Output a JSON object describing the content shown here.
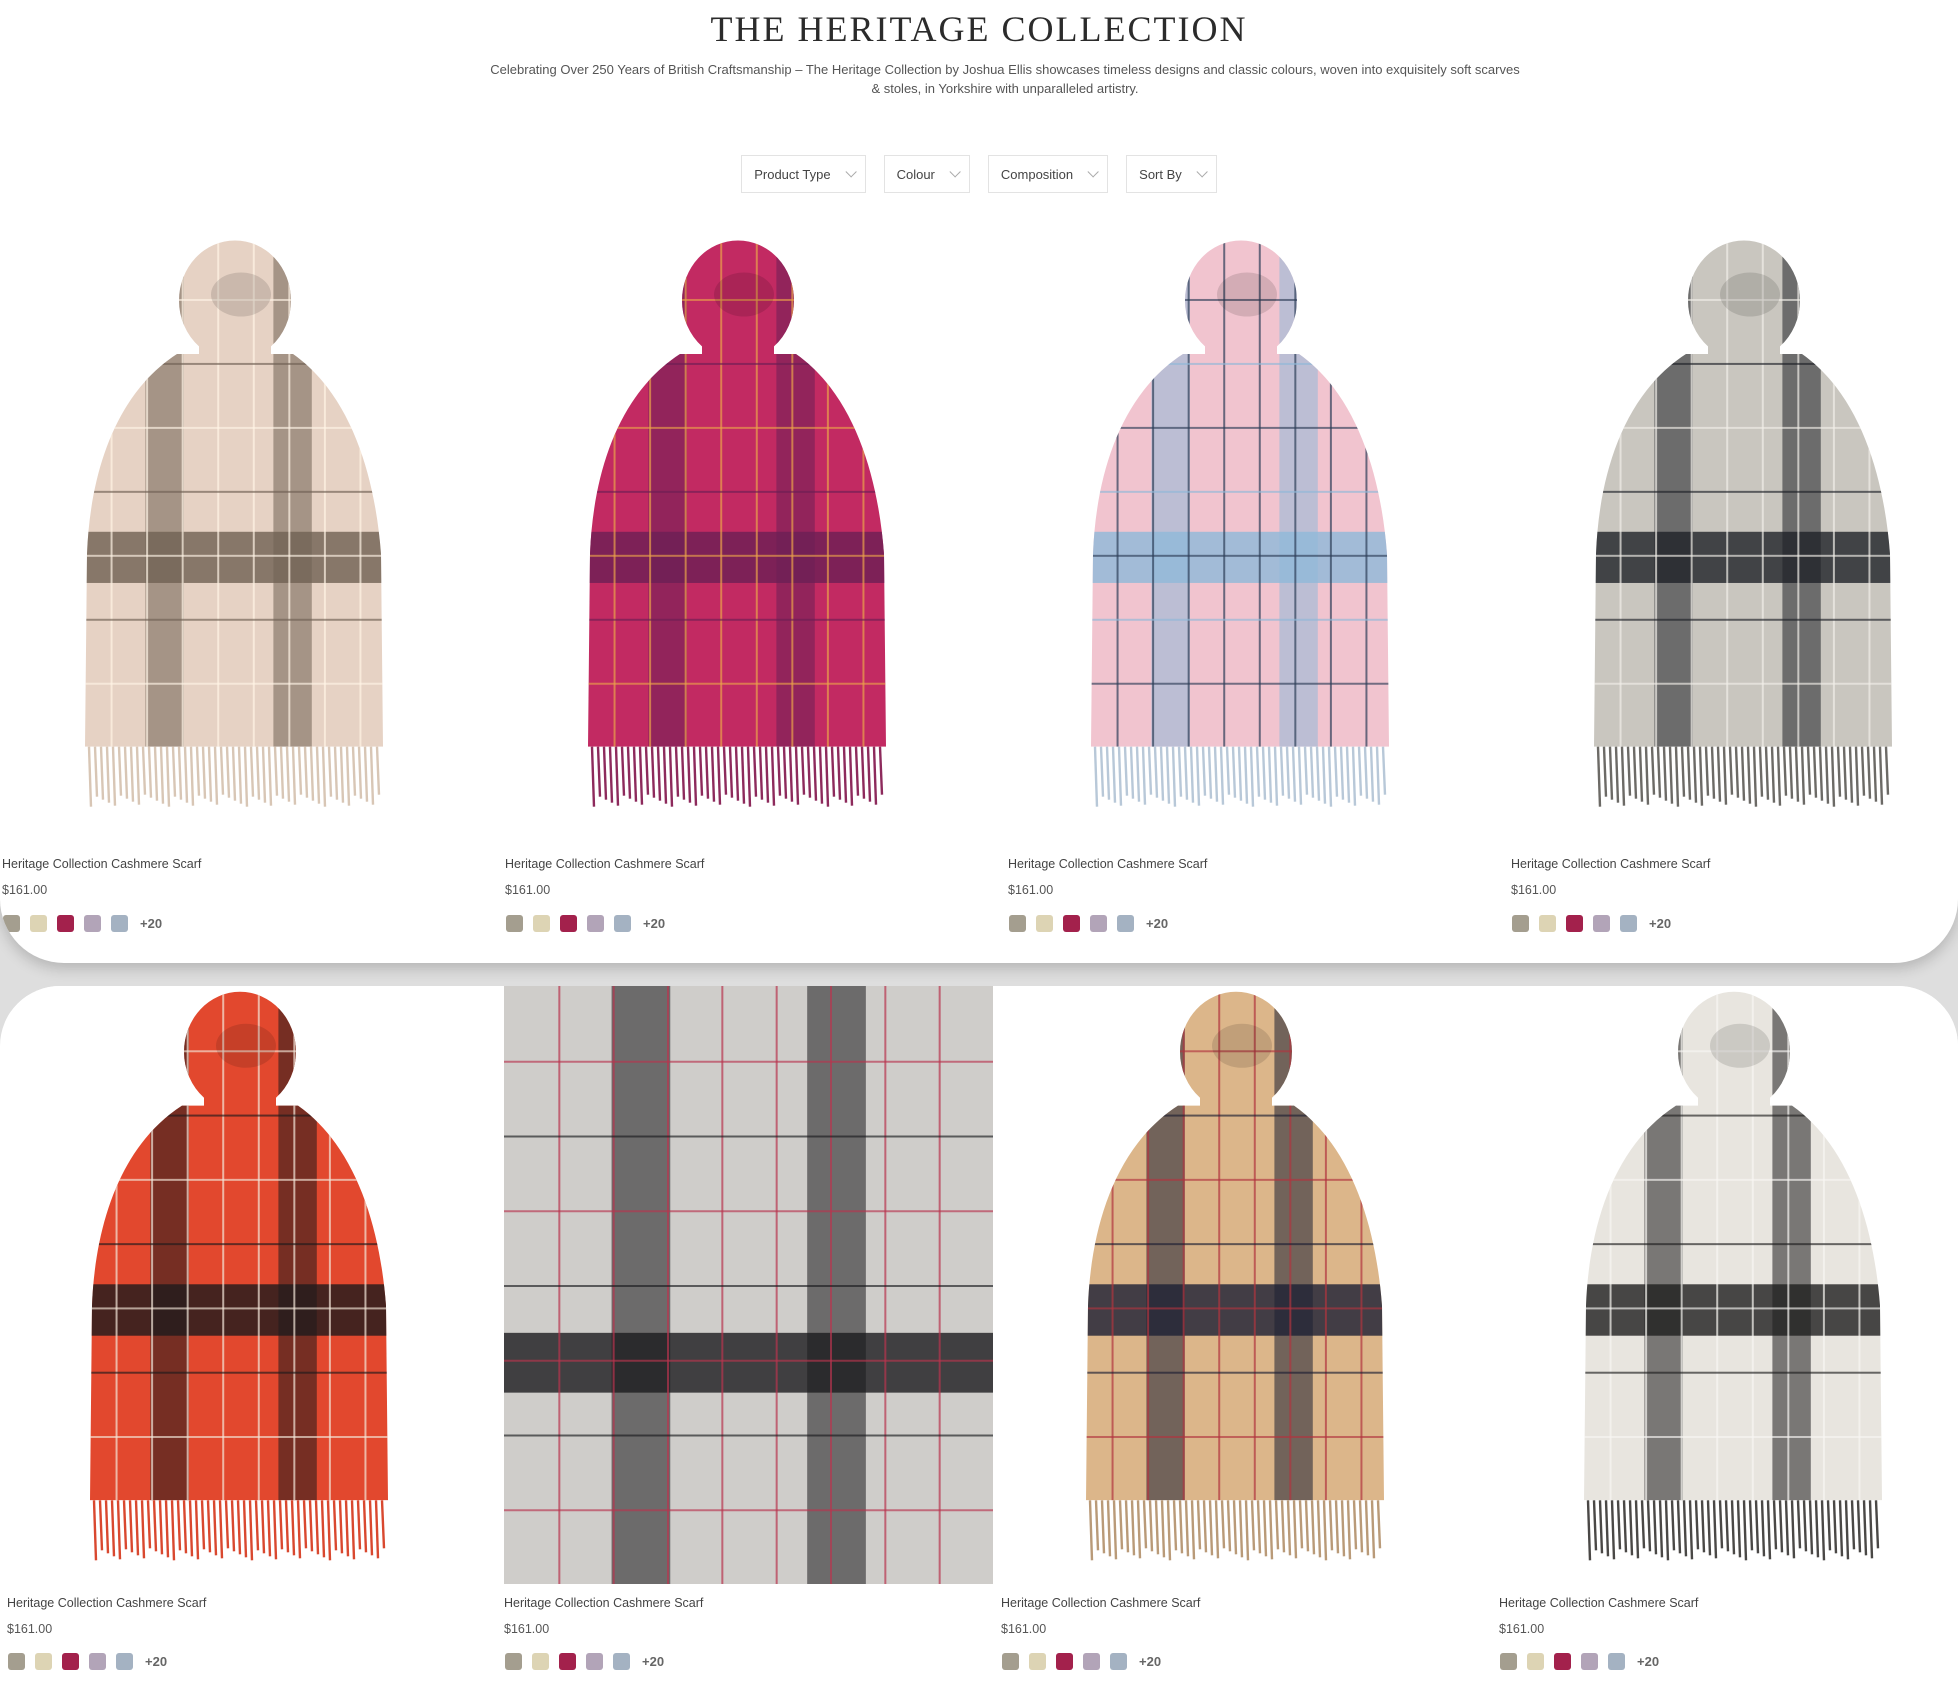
{
  "header": {
    "title": "THE HERITAGE COLLECTION",
    "description": "Celebrating Over 250 Years of British Craftsmanship – The Heritage Collection by Joshua Ellis showcases timeless designs and classic colours, woven into exquisitely soft scarves & stoles, in Yorkshire with unparalleled artistry."
  },
  "filters": {
    "product_type": "Product Type",
    "colour": "Colour",
    "composition": "Composition",
    "sort_by": "Sort By"
  },
  "swatch_colors": [
    "#a49e8f",
    "#ddd4b4",
    "#a3214c",
    "#b2a4b8",
    "#a4b2c2"
  ],
  "products": [
    {
      "name": "Heritage Collection Cashmere Scarf",
      "price": "$161.00",
      "more": "+20",
      "palette": {
        "base": "#e6d2c4",
        "band": "#6f6053",
        "line": "#fff4e6",
        "fringe": "#d8c6b5"
      }
    },
    {
      "name": "Heritage Collection Cashmere Scarf",
      "price": "$161.00",
      "more": "+20",
      "palette": {
        "base": "#c22a62",
        "band": "#6b1f55",
        "line": "#e9a24a",
        "fringe": "#8d2a5c"
      }
    },
    {
      "name": "Heritage Collection Cashmere Scarf",
      "price": "$161.00",
      "more": "+20",
      "palette": {
        "base": "#f1c4cf",
        "band": "#8fb9d8",
        "line": "#2e3e58",
        "fringe": "#b8c8d8"
      }
    },
    {
      "name": "Heritage Collection Cashmere Scarf",
      "price": "$161.00",
      "more": "+20",
      "palette": {
        "base": "#c9c6bf",
        "band": "#1f2228",
        "line": "#f1eee8",
        "fringe": "#6c6a66"
      }
    },
    {
      "name": "Heritage Collection Cashmere Scarf",
      "price": "$161.00",
      "more": "+20",
      "palette": {
        "base": "#e2482e",
        "band": "#1e1a1c",
        "line": "#f3e6d8",
        "fringe": "#d9482f"
      }
    },
    {
      "name": "Heritage Collection Cashmere Scarf",
      "price": "$161.00",
      "more": "+20",
      "palette": {
        "base": "#cfcdca",
        "band": "#1c1c1e",
        "line": "#b8344f",
        "fringe": "#cfcdca"
      }
    },
    {
      "name": "Heritage Collection Cashmere Scarf",
      "price": "$161.00",
      "more": "+20",
      "palette": {
        "base": "#dcb68a",
        "band": "#1b1f33",
        "line": "#b0343f",
        "fringe": "#b99a78"
      }
    },
    {
      "name": "Heritage Collection Cashmere Scarf",
      "price": "$161.00",
      "more": "+20",
      "palette": {
        "base": "#e8e5df",
        "band": "#1e1e1e",
        "line": "#f8f6f2",
        "fringe": "#4a4846"
      }
    }
  ]
}
